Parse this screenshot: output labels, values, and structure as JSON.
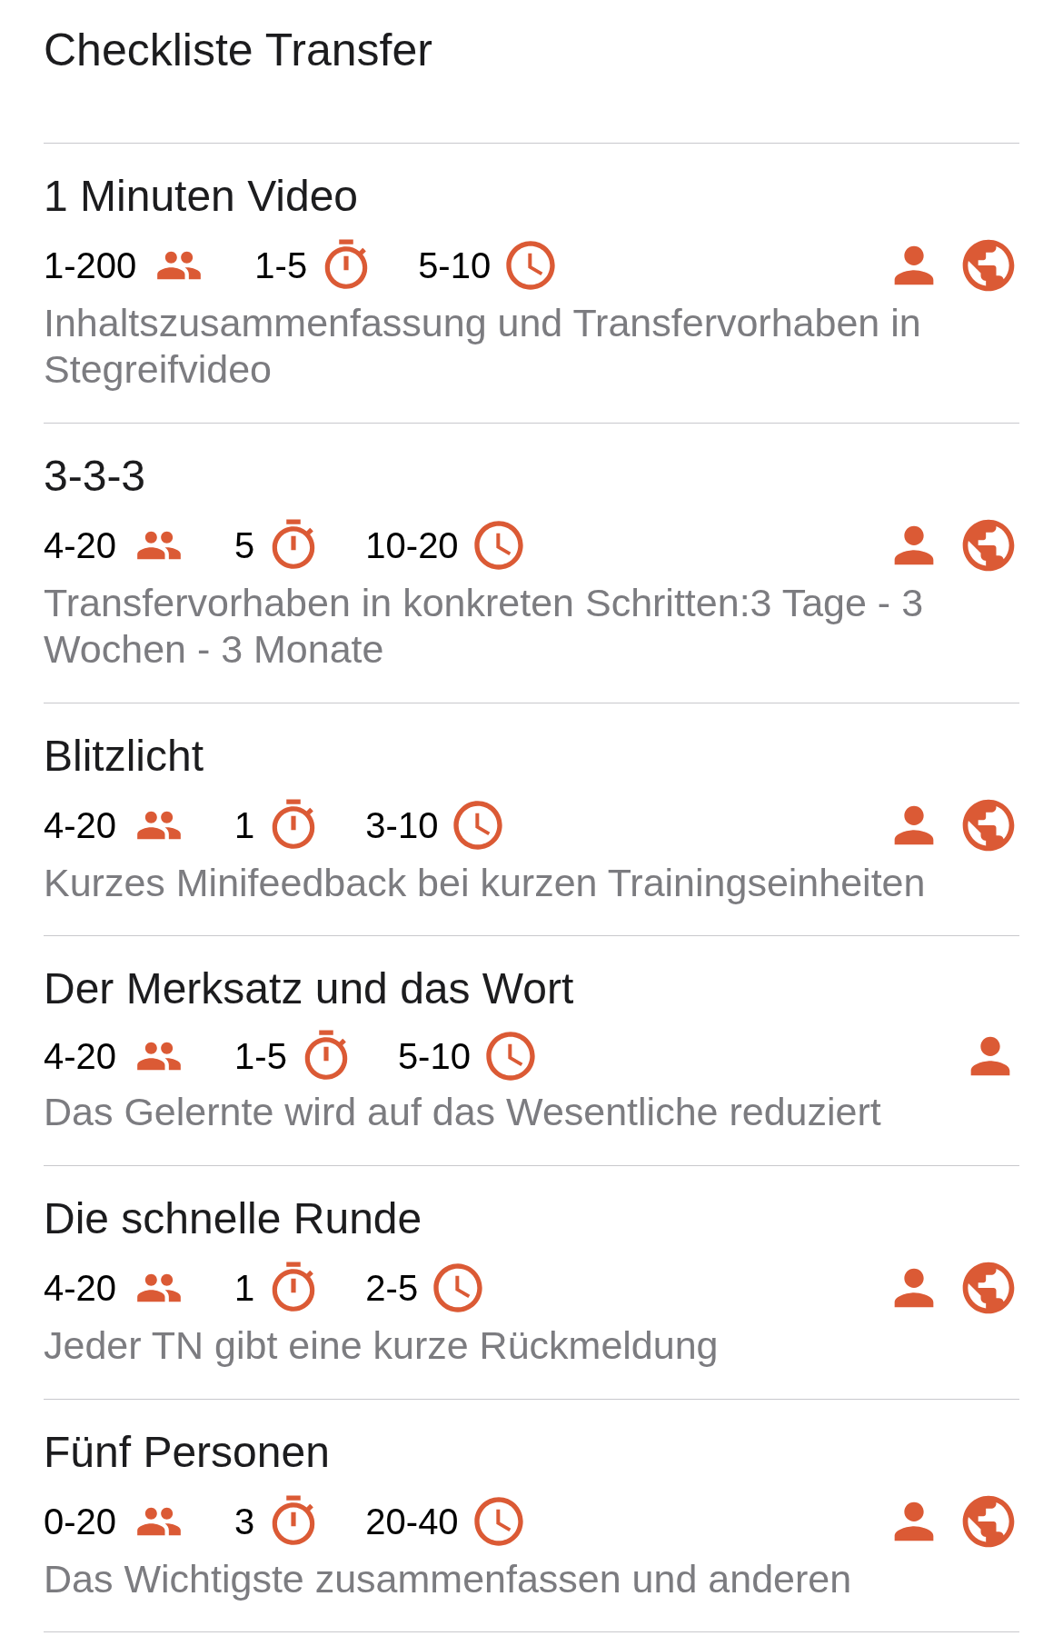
{
  "title": "Checkliste Transfer",
  "items": [
    {
      "name": "1 Minuten Video",
      "participants": "1-200",
      "duration": "1-5",
      "prep": "5-10",
      "online": true,
      "description": "Inhaltszusammenfassung und Transfervorhaben in Stegreifvideo"
    },
    {
      "name": "3-3-3",
      "participants": "4-20",
      "duration": "5",
      "prep": "10-20",
      "online": true,
      "description": "Transfervorhaben in konkreten Schritten:3 Tage - 3 Wochen - 3 Monate"
    },
    {
      "name": "Blitzlicht",
      "participants": "4-20",
      "duration": "1",
      "prep": "3-10",
      "online": true,
      "description": "Kurzes Minifeedback bei kurzen Trainingseinheiten"
    },
    {
      "name": "Der Merksatz und das Wort",
      "participants": "4-20",
      "duration": "1-5",
      "prep": "5-10",
      "online": false,
      "description": "Das Gelernte wird auf das Wesentliche reduziert"
    },
    {
      "name": "Die schnelle Runde",
      "participants": "4-20",
      "duration": "1",
      "prep": "2-5",
      "online": true,
      "description": "Jeder TN gibt eine kurze Rückmeldung"
    },
    {
      "name": "Fünf Personen",
      "participants": "0-20",
      "duration": "3",
      "prep": "20-40",
      "online": true,
      "description": "Das Wichtigste zusammenfassen und anderen"
    }
  ]
}
